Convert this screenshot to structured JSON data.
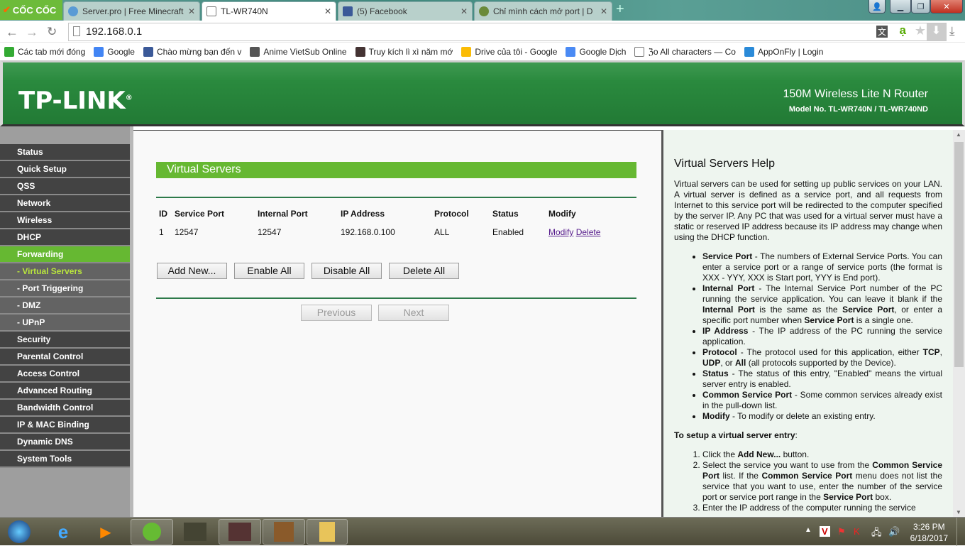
{
  "browser": {
    "brand": "CỐC CỐC",
    "tabs": [
      {
        "title": "Server.pro | Free Minecraft",
        "icon": "serverpro-icon"
      },
      {
        "title": "TL-WR740N",
        "icon": "page-icon",
        "active": true
      },
      {
        "title": "(5) Facebook",
        "icon": "facebook-icon"
      },
      {
        "title": "Chỉ mình cách mở port | D",
        "icon": "minecraft-icon"
      }
    ],
    "url": "192.168.0.1",
    "bookmarks": [
      {
        "label": "Các tab mới đóng",
        "icon": "history-icon"
      },
      {
        "label": "Google",
        "icon": "google-icon"
      },
      {
        "label": "Chào mừng bạn đến v",
        "icon": "facebook-icon"
      },
      {
        "label": "Anime VietSub Online",
        "icon": "anime-icon"
      },
      {
        "label": "Truy kích lì xì năm mớ",
        "icon": "game-icon"
      },
      {
        "label": "Drive của tôi - Google",
        "icon": "drive-icon"
      },
      {
        "label": "Google Dịch",
        "icon": "translate-icon"
      },
      {
        "label": "ℨo All characters — Co",
        "icon": "page-icon"
      },
      {
        "label": "AppOnFly | Login",
        "icon": "paper-plane-icon"
      }
    ]
  },
  "router": {
    "logo": "TP-LINK®",
    "product": "150M Wireless Lite N Router",
    "model": "Model No. TL-WR740N / TL-WR740ND",
    "accent": "#66b832"
  },
  "menu": [
    {
      "label": "Status"
    },
    {
      "label": "Quick Setup"
    },
    {
      "label": "QSS"
    },
    {
      "label": "Network"
    },
    {
      "label": "Wireless"
    },
    {
      "label": "DHCP"
    },
    {
      "label": "Forwarding",
      "state": "active"
    },
    {
      "label": "- Virtual Servers",
      "sub": true,
      "state": "selected"
    },
    {
      "label": "- Port Triggering",
      "sub": true
    },
    {
      "label": "- DMZ",
      "sub": true
    },
    {
      "label": "- UPnP",
      "sub": true
    },
    {
      "label": "Security"
    },
    {
      "label": "Parental Control"
    },
    {
      "label": "Access Control"
    },
    {
      "label": "Advanced Routing"
    },
    {
      "label": "Bandwidth Control"
    },
    {
      "label": "IP & MAC Binding"
    },
    {
      "label": "Dynamic DNS"
    },
    {
      "label": "System Tools"
    }
  ],
  "main": {
    "title": "Virtual Servers",
    "columns": [
      "ID",
      "Service Port",
      "Internal Port",
      "IP Address",
      "Protocol",
      "Status",
      "Modify"
    ],
    "rows": [
      {
        "id": "1",
        "service_port": "12547",
        "internal_port": "12547",
        "ip": "192.168.0.100",
        "protocol": "ALL",
        "status": "Enabled",
        "modify": "Modify",
        "delete": "Delete"
      }
    ],
    "buttons": {
      "add": "Add New...",
      "enable": "Enable All",
      "disable": "Disable All",
      "delete": "Delete All",
      "prev": "Previous",
      "next": "Next"
    }
  },
  "help": {
    "title": "Virtual Servers Help",
    "intro": "Virtual servers can be used for setting up public services on your LAN. A virtual server is defined as a service port, and all requests from Internet to this service port will be redirected to the computer specified by the server IP. Any PC that was used for a virtual server must have a static or reserved IP address because its IP address may change when using the DHCP function.",
    "items": [
      [
        {
          "b": 1,
          "t": "Service Port"
        },
        {
          "t": " - The numbers of External Service Ports. You can enter a service port or a range of service ports (the format is XXX - YYY, XXX is Start port, YYY is End port)."
        }
      ],
      [
        {
          "b": 1,
          "t": "Internal Port"
        },
        {
          "t": " - The Internal Service Port number of the PC running the service application. You can leave it blank if the "
        },
        {
          "b": 1,
          "t": "Internal Port"
        },
        {
          "t": " is the same as the "
        },
        {
          "b": 1,
          "t": "Service Port"
        },
        {
          "t": ", or enter a specific port number when "
        },
        {
          "b": 1,
          "t": "Service Port"
        },
        {
          "t": " is a single one."
        }
      ],
      [
        {
          "b": 1,
          "t": "IP Address"
        },
        {
          "t": " - The IP address of the PC running the service application."
        }
      ],
      [
        {
          "b": 1,
          "t": "Protocol"
        },
        {
          "t": " - The protocol used for this application, either "
        },
        {
          "b": 1,
          "t": "TCP"
        },
        {
          "t": ", "
        },
        {
          "b": 1,
          "t": "UDP"
        },
        {
          "t": ", or "
        },
        {
          "b": 1,
          "t": "All"
        },
        {
          "t": " (all protocols supported by the Device)."
        }
      ],
      [
        {
          "b": 1,
          "t": "Status"
        },
        {
          "t": " - The status of this entry, \"Enabled\" means the virtual server entry is enabled."
        }
      ],
      [
        {
          "b": 1,
          "t": "Common Service Port"
        },
        {
          "t": " - Some common services already exist in the pull-down list."
        }
      ],
      [
        {
          "b": 1,
          "t": "Modify"
        },
        {
          "t": " - To modify or delete an existing entry."
        }
      ]
    ],
    "setup_title": [
      {
        "b": 1,
        "t": "To setup a virtual server entry"
      },
      {
        "t": ":"
      }
    ],
    "steps": [
      [
        {
          "t": "Click the "
        },
        {
          "b": 1,
          "t": "Add New..."
        },
        {
          "t": " button."
        }
      ],
      [
        {
          "t": "Select the service you want to use from the "
        },
        {
          "b": 1,
          "t": "Common Service Port"
        },
        {
          "t": " list. If the "
        },
        {
          "b": 1,
          "t": "Common Service Port"
        },
        {
          "t": " menu does not list the service that you want to use, enter the number of the service port or service port range in the "
        },
        {
          "b": 1,
          "t": "Service Port"
        },
        {
          "t": " box."
        }
      ],
      [
        {
          "t": "Enter the IP address of the computer running the service"
        }
      ]
    ]
  },
  "taskbar": {
    "apps": [
      "start-orb",
      "internet-explorer-icon",
      "media-player-icon",
      "coccoc-icon",
      "truy-kich-icon",
      "truy-kich-2-icon",
      "minecraft-icon",
      "folder-icon"
    ],
    "time": "3:26 PM",
    "date": "6/18/2017"
  }
}
